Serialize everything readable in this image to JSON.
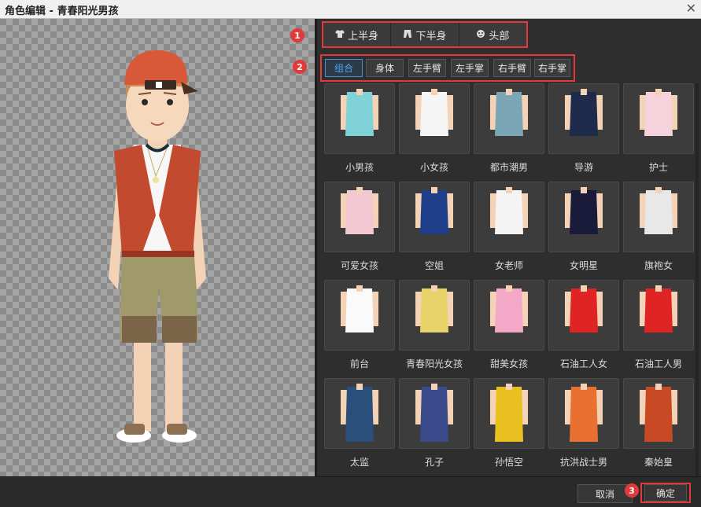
{
  "window": {
    "title": "角色编辑 - 青春阳光男孩",
    "close_icon": "close-icon"
  },
  "main_tabs": [
    {
      "label": "上半身",
      "icon": "shirt-icon"
    },
    {
      "label": "下半身",
      "icon": "pants-icon"
    },
    {
      "label": "头部",
      "icon": "face-icon"
    }
  ],
  "sub_tabs": [
    {
      "label": "组合",
      "active": true
    },
    {
      "label": "身体",
      "active": false
    },
    {
      "label": "左手臂",
      "active": false
    },
    {
      "label": "左手掌",
      "active": false
    },
    {
      "label": "右手臂",
      "active": false
    },
    {
      "label": "右手掌",
      "active": false
    }
  ],
  "badges": [
    "1",
    "2",
    "3"
  ],
  "items": [
    {
      "label": "小男孩"
    },
    {
      "label": "小女孩"
    },
    {
      "label": "都市潮男"
    },
    {
      "label": "导游"
    },
    {
      "label": "护士"
    },
    {
      "label": "可爱女孩"
    },
    {
      "label": "空姐"
    },
    {
      "label": "女老师"
    },
    {
      "label": "女明星"
    },
    {
      "label": "旗袍女"
    },
    {
      "label": "前台"
    },
    {
      "label": "青春阳光女孩"
    },
    {
      "label": "甜美女孩"
    },
    {
      "label": "石油工人女"
    },
    {
      "label": "石油工人男"
    },
    {
      "label": "太监"
    },
    {
      "label": "孔子"
    },
    {
      "label": "孙悟空"
    },
    {
      "label": "抗洪战士男"
    },
    {
      "label": "秦始皇"
    }
  ],
  "buttons": {
    "cancel": "取消",
    "ok": "确定"
  },
  "colors": {
    "accent": "#4ea3f3",
    "highlight": "#e23a3a",
    "panel": "#2e2e2e"
  }
}
